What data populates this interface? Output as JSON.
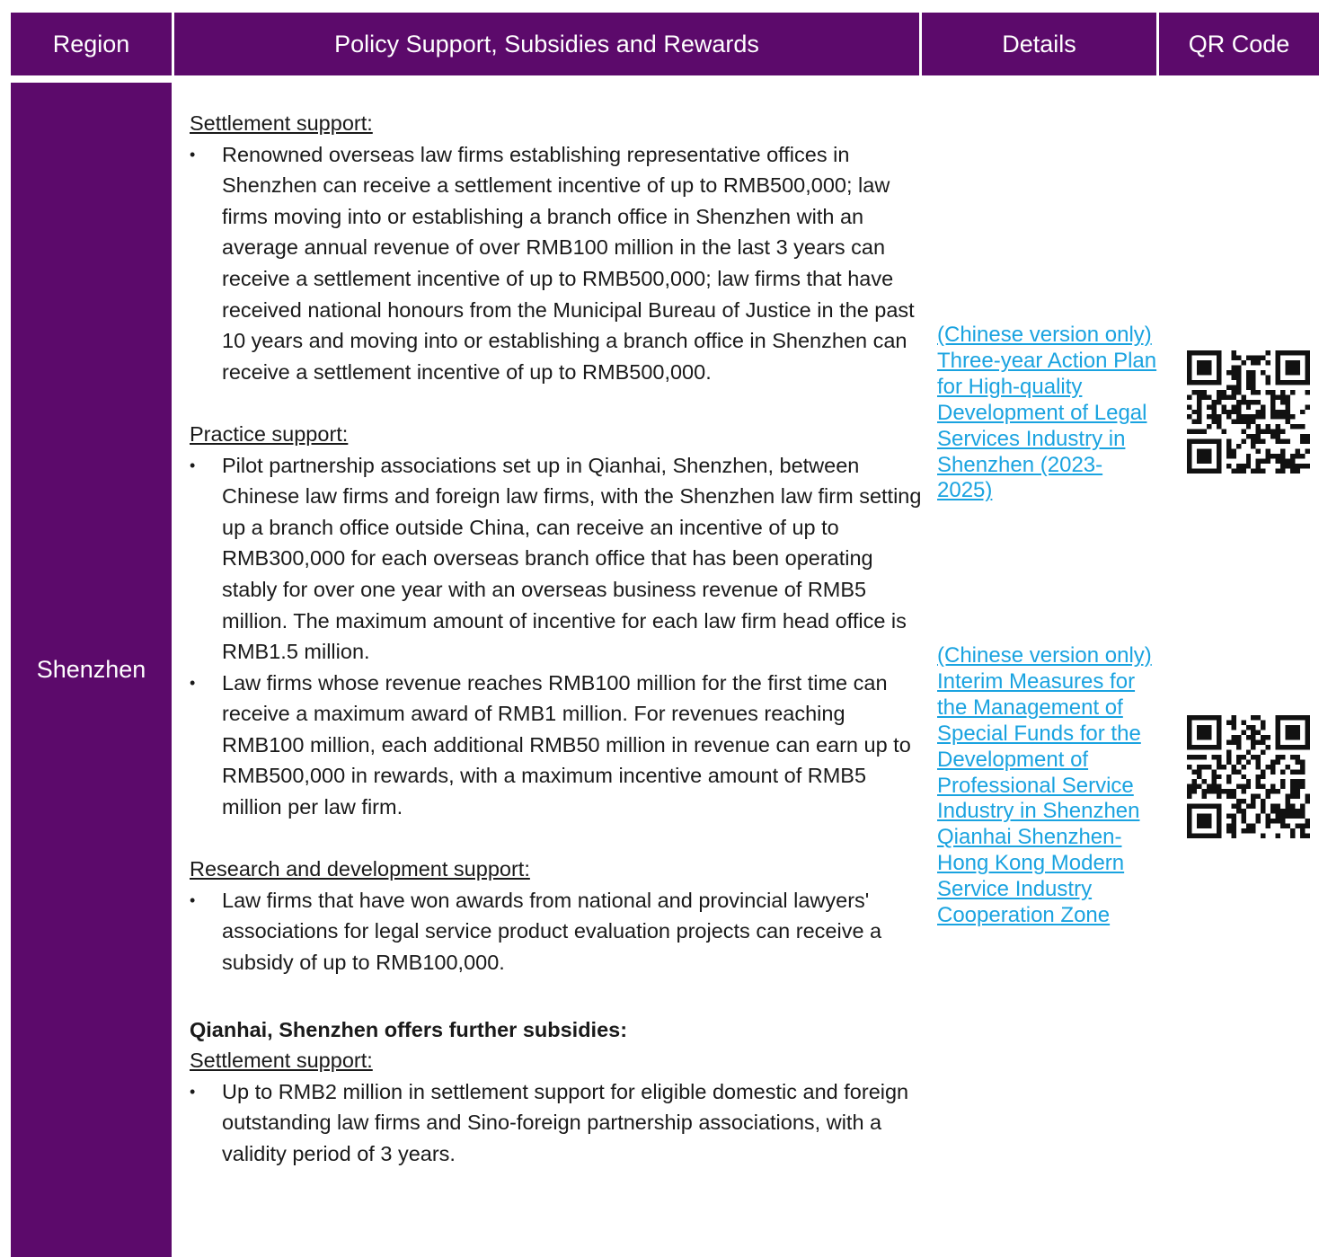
{
  "header": {
    "region": "Region",
    "policy": "Policy Support, Subsidies and Rewards",
    "details": "Details",
    "qr": "QR Code"
  },
  "row": {
    "region": "Shenzhen",
    "sections": {
      "settlement": {
        "title": "Settlement support:",
        "items": [
          "Renowned overseas law firms establishing representative offices in Shenzhen can receive a settlement incentive of up to RMB500,000; law firms moving into or establishing a branch office in Shenzhen with an average annual revenue of over RMB100 million in the last 3 years can receive a settlement incentive of up to RMB500,000; law firms that have received national honours from the Municipal Bureau of Justice in the past 10 years and moving into or establishing a branch office in Shenzhen can receive a settlement incentive of up to RMB500,000."
        ]
      },
      "practice": {
        "title": "Practice support:",
        "items": [
          "Pilot partnership associations set up in Qianhai, Shenzhen, between Chinese law firms and foreign law firms, with the Shenzhen law firm setting up a branch office outside China, can receive an incentive of up to RMB300,000 for each overseas branch office that has been operating stably for over one year with an overseas business revenue of RMB5 million. The maximum amount of incentive for each law firm head office is RMB1.5 million.",
          "Law firms whose revenue reaches RMB100 million for the first time can receive a maximum award of RMB1 million. For revenues reaching RMB100 million, each additional RMB50 million in revenue can earn up to RMB500,000 in rewards, with a maximum incentive amount of RMB5 million per law firm."
        ]
      },
      "research": {
        "title": "Research and development support:",
        "items": [
          "Law firms that have won awards from national and provincial lawyers' associations for legal service product evaluation projects can receive a subsidy of up to RMB100,000."
        ]
      },
      "qianhai": {
        "heading": "Qianhai, Shenzhen offers further subsidies:",
        "title": "Settlement support:",
        "items": [
          "Up to RMB2 million in settlement support for eligible domestic and foreign outstanding law firms and Sino-foreign partnership associations, with a validity period of 3 years."
        ]
      }
    },
    "details": [
      "(Chinese version only) Three-year Action Plan for High-quality Development of Legal Services Industry in Shenzhen (2023- 2025)",
      "(Chinese version only) Interim Measures for the Management of Special Funds for the Development of Professional Service Industry in Shenzhen Qianhai Shenzhen-Hong Kong Modern Service Industry Cooperation Zone"
    ]
  },
  "colors": {
    "header_bg": "#5c0a6b",
    "link": "#1aa3e0"
  }
}
